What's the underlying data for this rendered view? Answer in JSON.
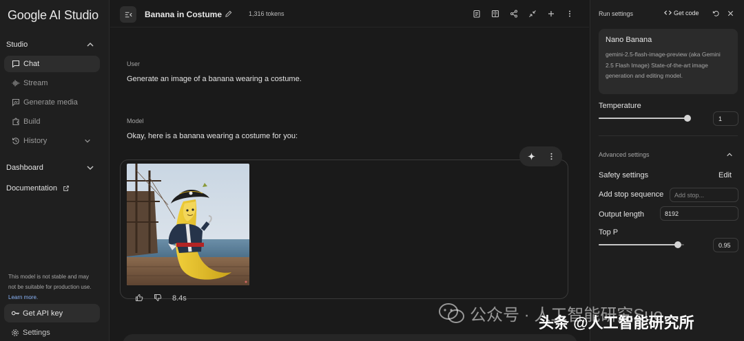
{
  "app": {
    "logo_text": "Google AI Studio"
  },
  "sidebar": {
    "studio_label": "Studio",
    "items": [
      {
        "label": "Chat",
        "icon": "chat-icon",
        "active": true
      },
      {
        "label": "Stream",
        "icon": "waveform-icon"
      },
      {
        "label": "Generate media",
        "icon": "media-icon"
      },
      {
        "label": "Build",
        "icon": "puzzle-icon"
      },
      {
        "label": "History",
        "icon": "history-icon"
      }
    ],
    "dashboard_label": "Dashboard",
    "documentation_label": "Documentation",
    "disclaimer_text": "This model is not stable and may not be suitable for production use.",
    "disclaimer_link": "Learn more.",
    "api_key_label": "Get API key",
    "settings_label": "Settings"
  },
  "header": {
    "title": "Banana in Costume",
    "tokens": "1,316 tokens"
  },
  "conversation": {
    "user_role": "User",
    "user_message": "Generate an image of a banana wearing a costume.",
    "model_role": "Model",
    "model_message": "Okay, here is a banana wearing a costume for you:",
    "latency": "8.4s"
  },
  "run_settings": {
    "title": "Run settings",
    "get_code_label": "Get code",
    "model_name": "Nano Banana",
    "model_description": "gemini-2.5-flash-image-preview (aka Gemini 2.5 Flash Image) State-of-the-art image generation and editing model.",
    "temperature_label": "Temperature",
    "temperature_value": "1",
    "temperature_fraction": 0.98,
    "advanced_label": "Advanced settings",
    "safety_label": "Safety settings",
    "safety_edit": "Edit",
    "stop_sequence_label": "Add stop sequence",
    "stop_sequence_placeholder": "Add stop...",
    "output_length_label": "Output length",
    "output_length_value": "8192",
    "top_p_label": "Top P",
    "top_p_value": "0.95",
    "top_p_fraction": 0.93
  },
  "watermark": {
    "line1": "公众号 · 人工智能研究Suo",
    "line2": "头条 @人工智能研究所"
  },
  "colors": {
    "accent_link": "#8ab4f8",
    "active_bg": "#2d2d2d"
  }
}
